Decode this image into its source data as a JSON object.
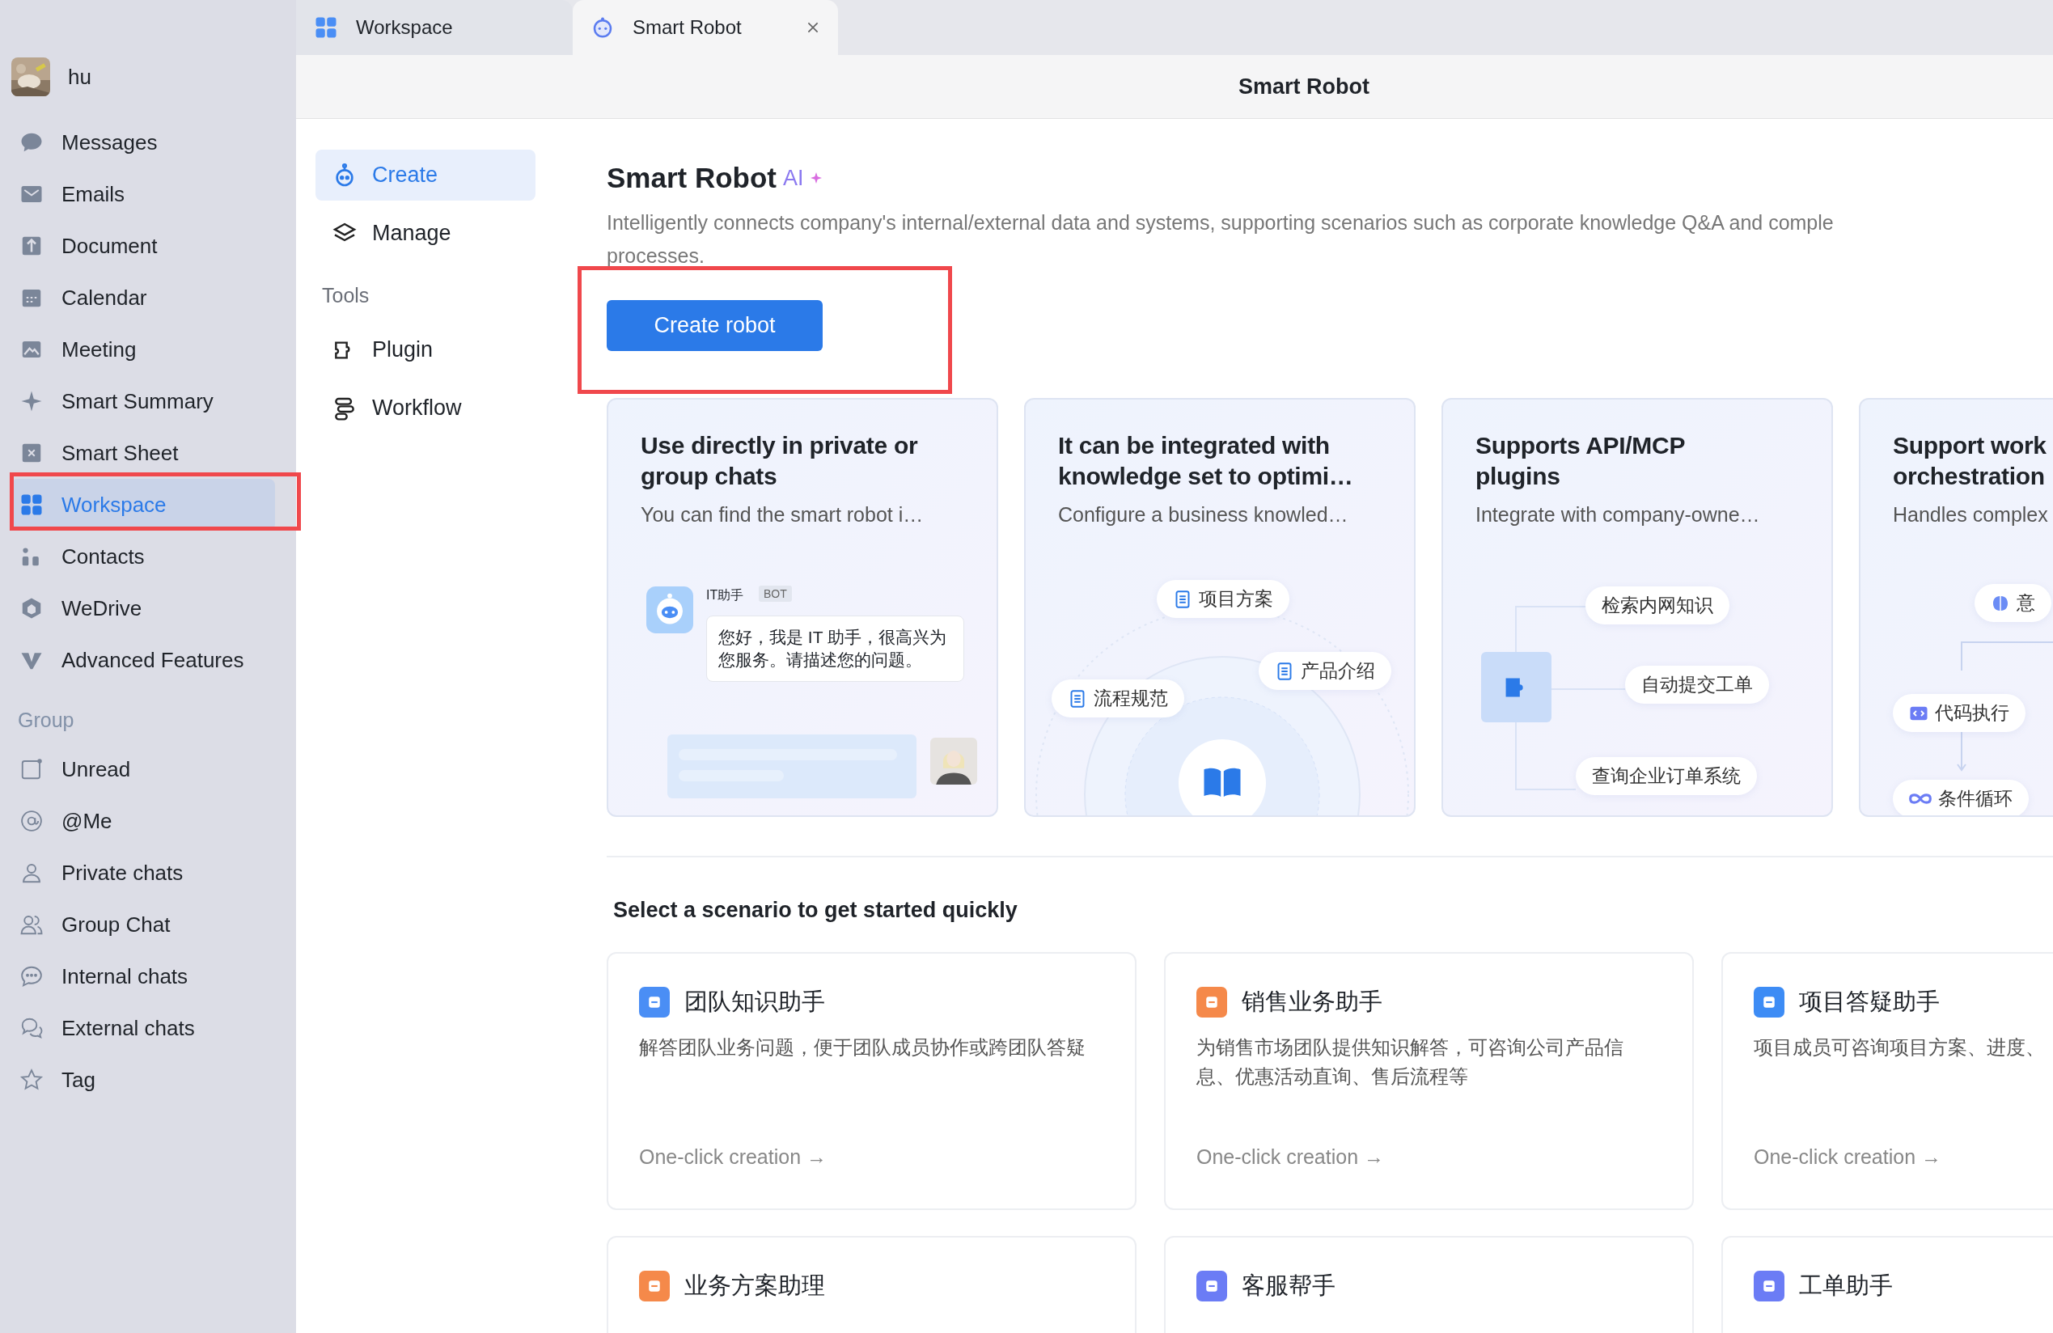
{
  "user": {
    "name": "hu"
  },
  "tabs": [
    {
      "label": "Workspace",
      "selected": false,
      "closable": false
    },
    {
      "label": "Smart Robot",
      "selected": true,
      "closable": true
    }
  ],
  "sidebar": {
    "items": [
      {
        "label": "Messages",
        "selected": false
      },
      {
        "label": "Emails",
        "selected": false
      },
      {
        "label": "Document",
        "selected": false
      },
      {
        "label": "Calendar",
        "selected": false
      },
      {
        "label": "Meeting",
        "selected": false
      },
      {
        "label": "Smart Summary",
        "selected": false
      },
      {
        "label": "Smart Sheet",
        "selected": false
      },
      {
        "label": "Workspace",
        "selected": true
      },
      {
        "label": "Contacts",
        "selected": false
      },
      {
        "label": "WeDrive",
        "selected": false
      },
      {
        "label": "Advanced Features",
        "selected": false
      }
    ],
    "group_heading": "Group",
    "group_items": [
      {
        "label": "Unread",
        "selected": false
      },
      {
        "label": "@Me",
        "selected": false
      },
      {
        "label": "Private chats",
        "selected": false
      },
      {
        "label": "Group Chat",
        "selected": false
      },
      {
        "label": "Internal chats",
        "selected": false
      },
      {
        "label": "External chats",
        "selected": false
      },
      {
        "label": "Tag",
        "selected": false
      }
    ]
  },
  "header": {
    "title": "Smart Robot"
  },
  "subnav": {
    "items": [
      {
        "label": "Create",
        "selected": true
      },
      {
        "label": "Manage",
        "selected": false
      }
    ],
    "tools_heading": "Tools",
    "tools": [
      {
        "label": "Plugin",
        "selected": false
      },
      {
        "label": "Workflow",
        "selected": false
      }
    ]
  },
  "intro": {
    "title": "Smart Robot",
    "badge": "AI",
    "description_lines": [
      "Intelligently connects company's internal/external data and systems, supporting scenarios such as corporate knowledge Q&A and comple",
      "processes."
    ],
    "button": "Create robot"
  },
  "features": [
    {
      "kind": "chat",
      "title_lines": [
        "Use directly in private or",
        "group chats"
      ],
      "subtitle": "You can find the smart robot i…",
      "bot_name": "IT助手",
      "bot_tag": "BOT",
      "message": "您好，我是 IT 助手，很高兴为您服务。请描述您的问题。"
    },
    {
      "kind": "knowledge",
      "title_lines": [
        "It can be integrated with",
        "knowledge set to optimi…"
      ],
      "subtitle": "Configure a business knowled…",
      "chips": [
        "项目方案",
        "产品介绍",
        "流程规范"
      ]
    },
    {
      "kind": "plugin",
      "title_lines": [
        "Supports API/MCP",
        "plugins"
      ],
      "subtitle": "Integrate with company-owne…",
      "chips": [
        "检索内网知识",
        "自动提交工单",
        "查询企业订单系统"
      ]
    },
    {
      "kind": "workflow",
      "title_lines": [
        "Support work",
        "orchestration"
      ],
      "subtitle": "Handles complex",
      "chips": [
        "意",
        "代码执行",
        "条件循环"
      ]
    }
  ],
  "scenarios": {
    "heading": "Select a scenario to get started quickly",
    "cards": [
      {
        "title": "团队知识助手",
        "description": "解答团队业务问题，便于团队成员协作或跨团队答疑",
        "link": "One-click creation →",
        "color": "#4a8ef5"
      },
      {
        "title": "销售业务助手",
        "description": "为销售市场团队提供知识解答，可咨询公司产品信息、优惠活动直询、售后流程等",
        "link": "One-click creation →",
        "color": "#f5894a"
      },
      {
        "title": "项目答疑助手",
        "description": "项目成员可咨询项目方案、进度、",
        "link": "One-click creation →",
        "color": "#3d8cf5"
      },
      {
        "title": "业务方案助理",
        "color": "#f5894a"
      },
      {
        "title": "客服帮手",
        "color": "#6b7cf5"
      },
      {
        "title": "工单助手",
        "color": "#6b7cf5"
      }
    ]
  }
}
